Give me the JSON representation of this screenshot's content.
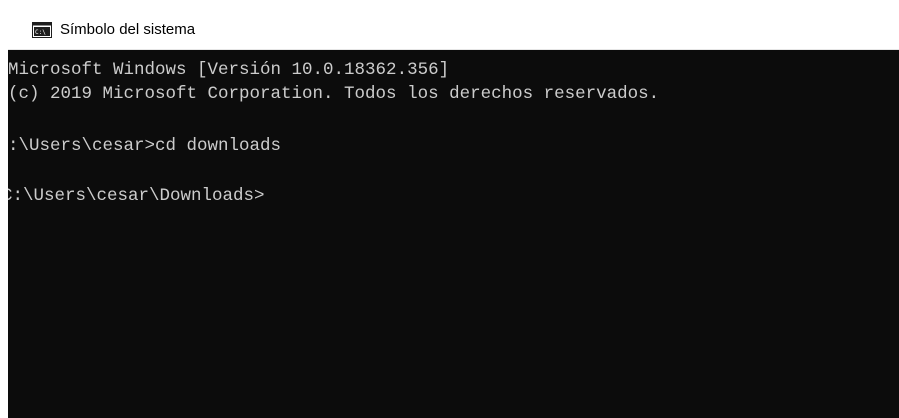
{
  "colors": {
    "console_background": "#0c0c0c",
    "console_text": "#cccccc",
    "titlebar_background": "#ffffff"
  },
  "window": {
    "title": "Símbolo del sistema",
    "icon": "cmd-icon"
  },
  "console": {
    "lines": [
      "Microsoft Windows [Versión 10.0.18362.356]",
      "(c) 2019 Microsoft Corporation. Todos los derechos reservados.",
      ":\\Users\\cesar>cd downloads",
      "C:\\Users\\cesar\\Downloads>"
    ]
  }
}
